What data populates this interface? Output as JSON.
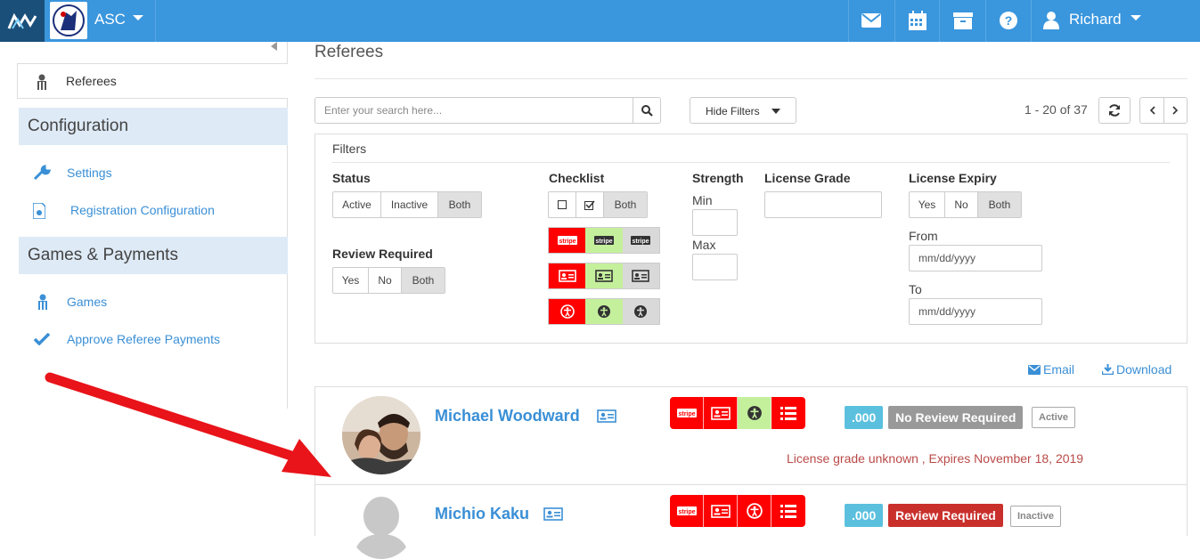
{
  "topbar": {
    "club_name": "ASC",
    "user_name": "Richard",
    "icons": [
      "envelope-icon",
      "calendar-icon",
      "archive-icon",
      "help-icon",
      "user-icon"
    ]
  },
  "sidebar": {
    "active_item": "Referees",
    "sections": [
      {
        "title": "Configuration",
        "items": [
          "Settings",
          "Registration Configuration"
        ]
      },
      {
        "title": "Games & Payments",
        "items": [
          "Games",
          "Approve Referee Payments"
        ]
      }
    ]
  },
  "main": {
    "title": "Referees",
    "search_placeholder": "Enter your search here...",
    "hide_filters": "Hide Filters",
    "pager": "1 - 20 of 37"
  },
  "filters": {
    "title": "Filters",
    "status": {
      "label": "Status",
      "options": [
        "Active",
        "Inactive",
        "Both"
      ],
      "selected": "Both"
    },
    "review": {
      "label": "Review Required",
      "options": [
        "Yes",
        "No",
        "Both"
      ],
      "selected": "Both"
    },
    "checklist": {
      "label": "Checklist",
      "options": [
        "☐",
        "☑",
        "Both"
      ],
      "selected": "Both"
    },
    "strength": {
      "label": "Strength",
      "min": "Min",
      "max": "Max"
    },
    "license_grade": {
      "label": "License Grade"
    },
    "license_expiry": {
      "label": "License Expiry",
      "options": [
        "Yes",
        "No",
        "Both"
      ],
      "selected": "Both",
      "from_label": "From",
      "to_label": "To",
      "from_placeholder": "mm/dd/yyyy",
      "to_placeholder": "mm/dd/yyyy"
    }
  },
  "actions": {
    "email": "Email",
    "download": "Download"
  },
  "referees": [
    {
      "name": "Michael Woodward",
      "score": ".000",
      "review": "No Review Required",
      "status": "Active",
      "license_note": "License grade unknown , Expires November 18, 2019",
      "checklist_colors": [
        "#ff0000",
        "#ff0000",
        "#c4f09c",
        "#ff0000"
      ]
    },
    {
      "name": "Michio Kaku",
      "score": ".000",
      "review": "Review Required",
      "status": "Inactive",
      "checklist_colors": [
        "#ff0000",
        "#ff0000",
        "#ff0000",
        "#ff0000"
      ]
    }
  ],
  "colors": {
    "topbar": "#3a96dd",
    "link": "#3a8fd6",
    "review_required": "#c9302c",
    "no_review": "#999999",
    "score": "#5bc0de"
  },
  "stripe_label": "stripe"
}
